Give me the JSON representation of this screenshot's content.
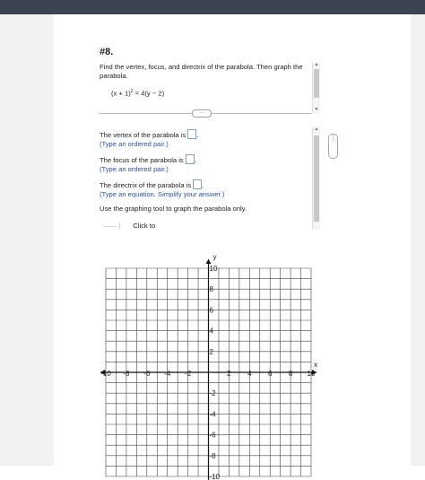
{
  "question": {
    "number": "#8.",
    "prompt": "Find the vertex, focus, and directrix of the parabola. Then graph the parabola.",
    "equation_left": "(x + 1)",
    "equation_exp": "2",
    "equation_right": " = 4(y − 2)"
  },
  "more_button": "···",
  "side_handle": "⋮",
  "answers": {
    "vertex_text": "The vertex of the parabola is",
    "vertex_hint": "(Type an ordered pair.)",
    "focus_text": "The focus of the parabola is",
    "focus_hint": "(Type an ordered pair.)",
    "directrix_text": "The directrix of the parabola is",
    "directrix_hint": "(Type an equation. Simplify your answer.)",
    "instruction": "Use the graphing tool to graph the parabola only.",
    "click_to": "Click to"
  },
  "graph": {
    "x_label": "x",
    "y_label": "y",
    "x_min": -10,
    "x_max": 10,
    "y_min": -10,
    "y_max": 10,
    "grid": true,
    "tick_values_x": [
      -10,
      -8,
      -6,
      -4,
      -2,
      2,
      4,
      6,
      8,
      10
    ],
    "tick_values_y": [
      10,
      8,
      6,
      4,
      2,
      -2,
      -4,
      -6,
      -8,
      -10
    ]
  },
  "colors": {
    "topbar": "#3d4451",
    "hint": "#2a4fb0",
    "grid": "#444444"
  }
}
